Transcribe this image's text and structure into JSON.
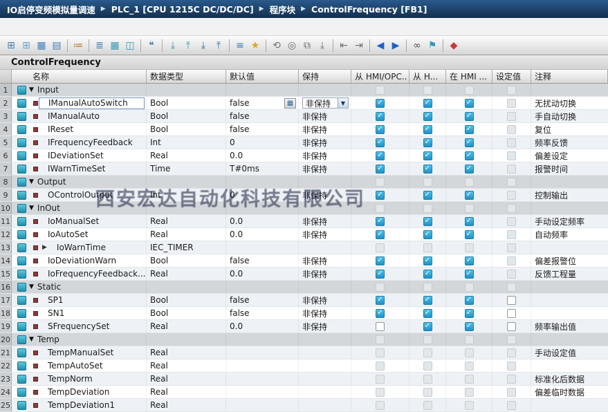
{
  "breadcrumb": {
    "items": [
      "IO启停变频模拟量调速",
      "PLC_1 [CPU 1215C DC/DC/DC]",
      "程序块",
      "ControlFrequency [FB1]"
    ]
  },
  "toolbar": {
    "items": [
      {
        "name": "insert-row-icon",
        "glyph": "⊞",
        "color": "#3f7fb5"
      },
      {
        "name": "add-row-icon",
        "glyph": "⊞",
        "color": "#6fa0c8"
      },
      {
        "name": "insert-parameter-icon",
        "glyph": "▦",
        "color": "#3f7fb5"
      },
      {
        "name": "append-parameter-icon",
        "glyph": "▤",
        "color": "#3f7fb5"
      },
      {
        "sep": true
      },
      {
        "name": "reset-start-values-icon",
        "glyph": "≔",
        "color": "#b5731e"
      },
      {
        "sep": true
      },
      {
        "name": "sort-list-icon",
        "glyph": "≣",
        "color": "#3f7fb5"
      },
      {
        "name": "data-view-icon",
        "glyph": "▦",
        "color": "#2e9bb5"
      },
      {
        "name": "split-view-icon",
        "glyph": "◫",
        "color": "#2e9bb5"
      },
      {
        "sep": true
      },
      {
        "name": "comment-icon",
        "glyph": "❝",
        "color": "#3f7fb5"
      },
      {
        "sep": true
      },
      {
        "name": "download-to-plc-icon",
        "glyph": "⤓",
        "color": "#2e9bb5"
      },
      {
        "name": "upload-from-plc-icon",
        "glyph": "⤒",
        "color": "#2e9bb5"
      },
      {
        "name": "download-all-icon",
        "glyph": "⤓",
        "color": "#27739b"
      },
      {
        "name": "upload-all-icon",
        "glyph": "⤒",
        "color": "#27739b"
      },
      {
        "sep": true
      },
      {
        "name": "favorites-list-icon",
        "glyph": "≡",
        "color": "#3f7fb5"
      },
      {
        "name": "favorites-star-icon",
        "glyph": "★",
        "color": "#e0a321"
      },
      {
        "sep": true
      },
      {
        "name": "undo-snapshot-icon",
        "glyph": "⟲",
        "color": "#6f6f6f"
      },
      {
        "name": "snapshot-icon",
        "glyph": "◎",
        "color": "#6f6f6f"
      },
      {
        "name": "copy-snapshot-icon",
        "glyph": "⧉",
        "color": "#6f6f6f"
      },
      {
        "name": "apply-snapshot-icon",
        "glyph": "⤓",
        "color": "#6f6f6f"
      },
      {
        "sep": true
      },
      {
        "name": "expand-members-icon",
        "glyph": "⇤",
        "color": "#6f6f6f"
      },
      {
        "name": "collapse-members-icon",
        "glyph": "⇥",
        "color": "#6f6f6f"
      },
      {
        "sep": true
      },
      {
        "name": "monitor-backward-icon",
        "glyph": "◀",
        "color": "#1d62c8"
      },
      {
        "name": "monitor-forward-icon",
        "glyph": "▶",
        "color": "#1d62c8"
      },
      {
        "sep": true
      },
      {
        "name": "monitoring-glasses-icon",
        "glyph": "∞",
        "color": "#555555"
      },
      {
        "name": "modify-icon",
        "glyph": "⚑",
        "color": "#2e9bb5"
      },
      {
        "sep": true
      },
      {
        "name": "offline-icon",
        "glyph": "◆",
        "color": "#c23b3b"
      }
    ]
  },
  "title": "ControlFrequency",
  "watermark": "西安宏达自动化科技有限公司",
  "table": {
    "columns": [
      "名称",
      "数据类型",
      "默认值",
      "保持",
      "从 HMI/OPC..",
      "从 H...",
      "在 HMI ...",
      "设定值",
      "注释"
    ],
    "rows": [
      {
        "num": "1",
        "kind": "section",
        "name": "Input",
        "type": "",
        "default": "",
        "retain": "",
        "acc": "disabled",
        "h2": "disabled",
        "vis": "disabled",
        "sp": "disabled",
        "comment": ""
      },
      {
        "num": "2",
        "kind": "var",
        "editing": true,
        "name": "IManualAutoSwitch",
        "type": "Bool",
        "default": "false",
        "retain": "非保持",
        "retain_dropdown": true,
        "acc": "checked",
        "h2": "checked",
        "vis": "checked",
        "sp": "disabled",
        "comment": "无扰动切换"
      },
      {
        "num": "3",
        "kind": "var",
        "name": "IManualAuto",
        "type": "Bool",
        "default": "false",
        "retain": "非保持",
        "acc": "checked",
        "h2": "checked",
        "vis": "checked",
        "sp": "disabled",
        "comment": "手自动切换"
      },
      {
        "num": "4",
        "kind": "var",
        "name": "IReset",
        "type": "Bool",
        "default": "false",
        "retain": "非保持",
        "acc": "checked",
        "h2": "checked",
        "vis": "checked",
        "sp": "disabled",
        "comment": "复位"
      },
      {
        "num": "5",
        "kind": "var",
        "name": "IFrequencyFeedback",
        "type": "Int",
        "default": "0",
        "retain": "非保持",
        "acc": "checked",
        "h2": "checked",
        "vis": "checked",
        "sp": "disabled",
        "comment": "频率反馈"
      },
      {
        "num": "6",
        "kind": "var",
        "name": "IDeviationSet",
        "type": "Real",
        "default": "0.0",
        "retain": "非保持",
        "acc": "checked",
        "h2": "checked",
        "vis": "checked",
        "sp": "disabled",
        "comment": "偏差设定"
      },
      {
        "num": "7",
        "kind": "var",
        "name": "IWarnTimeSet",
        "type": "Time",
        "default": "T#0ms",
        "retain": "非保持",
        "acc": "checked",
        "h2": "checked",
        "vis": "checked",
        "sp": "disabled",
        "comment": "报警时间"
      },
      {
        "num": "8",
        "kind": "section",
        "name": "Output",
        "type": "",
        "default": "",
        "retain": "",
        "acc": "disabled",
        "h2": "disabled",
        "vis": "disabled",
        "sp": "disabled",
        "comment": ""
      },
      {
        "num": "9",
        "kind": "var",
        "name": "OControlOutput",
        "type": "Int",
        "default": "0",
        "retain": "非保持",
        "acc": "checked",
        "h2": "checked",
        "vis": "checked",
        "sp": "disabled",
        "comment": "控制输出"
      },
      {
        "num": "10",
        "kind": "section",
        "name": "InOut",
        "type": "",
        "default": "",
        "retain": "",
        "acc": "disabled",
        "h2": "disabled",
        "vis": "disabled",
        "sp": "disabled",
        "comment": ""
      },
      {
        "num": "11",
        "kind": "var",
        "name": "IoManualSet",
        "type": "Real",
        "default": "0.0",
        "retain": "非保持",
        "acc": "checked",
        "h2": "checked",
        "vis": "checked",
        "sp": "disabled",
        "comment": "手动设定频率"
      },
      {
        "num": "12",
        "kind": "var",
        "name": "IoAutoSet",
        "type": "Real",
        "default": "0.0",
        "retain": "非保持",
        "acc": "checked",
        "h2": "checked",
        "vis": "checked",
        "sp": "disabled",
        "comment": "自动频率"
      },
      {
        "num": "13",
        "kind": "var",
        "expand": true,
        "name": "IoWarnTime",
        "type": "IEC_TIMER",
        "default": "",
        "retain": "",
        "acc": "disabled",
        "h2": "disabled",
        "vis": "disabled",
        "sp": "disabled",
        "comment": ""
      },
      {
        "num": "14",
        "kind": "var",
        "name": "IoDeviationWarn",
        "type": "Bool",
        "default": "false",
        "retain": "非保持",
        "acc": "checked",
        "h2": "checked",
        "vis": "checked",
        "sp": "disabled",
        "comment": "偏差报警位"
      },
      {
        "num": "15",
        "kind": "var",
        "name": "IoFrequencyFeedback...",
        "type": "Real",
        "default": "0.0",
        "retain": "非保持",
        "acc": "checked",
        "h2": "checked",
        "vis": "checked",
        "sp": "disabled",
        "comment": "反馈工程量"
      },
      {
        "num": "16",
        "kind": "section",
        "name": "Static",
        "type": "",
        "default": "",
        "retain": "",
        "acc": "disabled",
        "h2": "disabled",
        "vis": "disabled",
        "sp": "disabled",
        "comment": ""
      },
      {
        "num": "17",
        "kind": "var",
        "name": "SP1",
        "type": "Bool",
        "default": "false",
        "retain": "非保持",
        "acc": "checked",
        "h2": "checked",
        "vis": "checked",
        "sp": "unchecked",
        "comment": ""
      },
      {
        "num": "18",
        "kind": "var",
        "name": "SN1",
        "type": "Bool",
        "default": "false",
        "retain": "非保持",
        "acc": "checked",
        "h2": "checked",
        "vis": "checked",
        "sp": "unchecked",
        "comment": ""
      },
      {
        "num": "19",
        "kind": "var",
        "name": "SFrequencySet",
        "type": "Real",
        "default": "0.0",
        "retain": "非保持",
        "acc": "unchecked",
        "h2": "checked",
        "vis": "checked",
        "sp": "unchecked",
        "comment": "频率输出值"
      },
      {
        "num": "20",
        "kind": "section",
        "name": "Temp",
        "type": "",
        "default": "",
        "retain": "",
        "acc": "disabled",
        "h2": "disabled",
        "vis": "disabled",
        "sp": "disabled",
        "comment": ""
      },
      {
        "num": "21",
        "kind": "var",
        "name": "TempManualSet",
        "type": "Real",
        "default": "",
        "retain": "",
        "acc": "disabled",
        "h2": "disabled",
        "vis": "disabled",
        "sp": "disabled",
        "comment": "手动设定值"
      },
      {
        "num": "22",
        "kind": "var",
        "name": "TempAutoSet",
        "type": "Real",
        "default": "",
        "retain": "",
        "acc": "disabled",
        "h2": "disabled",
        "vis": "disabled",
        "sp": "disabled",
        "comment": ""
      },
      {
        "num": "23",
        "kind": "var",
        "name": "TempNorm",
        "type": "Real",
        "default": "",
        "retain": "",
        "acc": "disabled",
        "h2": "disabled",
        "vis": "disabled",
        "sp": "disabled",
        "comment": "标准化后数据"
      },
      {
        "num": "24",
        "kind": "var",
        "name": "TempDeviation",
        "type": "Real",
        "default": "",
        "retain": "",
        "acc": "disabled",
        "h2": "disabled",
        "vis": "disabled",
        "sp": "disabled",
        "comment": "偏差临时数据"
      },
      {
        "num": "25",
        "kind": "var",
        "name": "TempDeviation1",
        "type": "Real",
        "default": "",
        "retain": "",
        "acc": "disabled",
        "h2": "disabled",
        "vis": "disabled",
        "sp": "disabled",
        "comment": ""
      }
    ]
  }
}
